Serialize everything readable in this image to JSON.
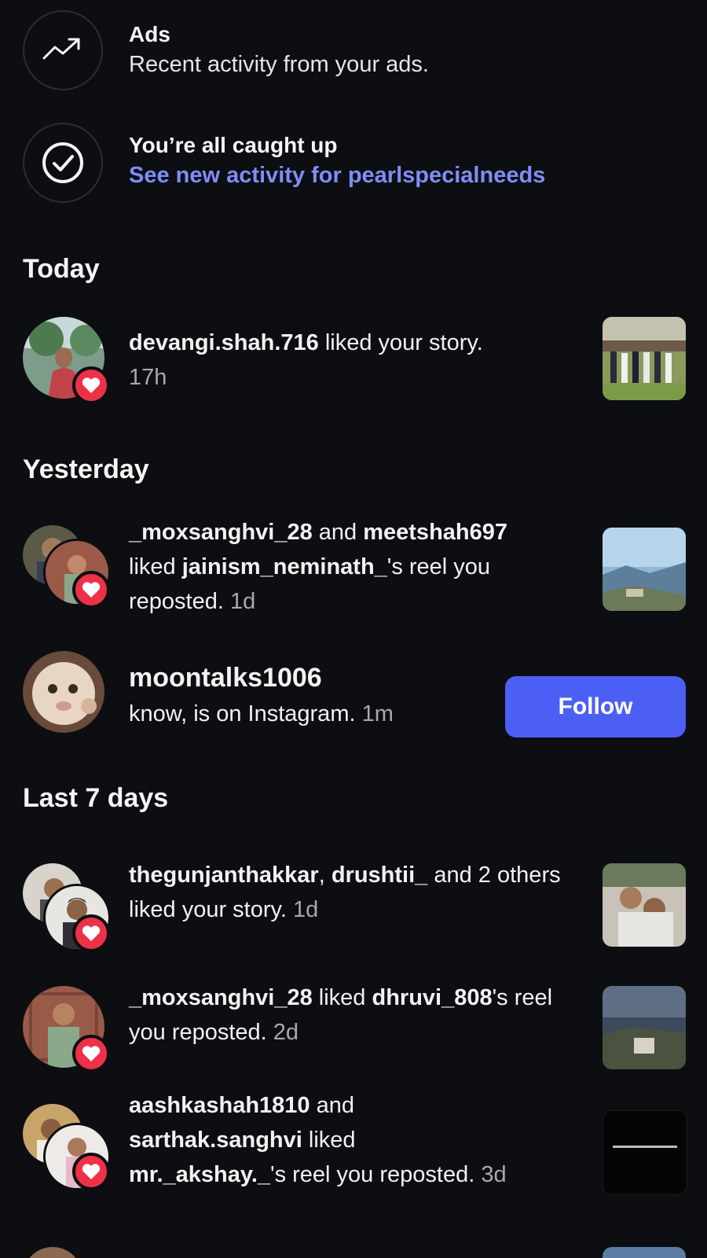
{
  "ads": {
    "title": "Ads",
    "subtitle": "Recent activity from your ads.",
    "icon": "trending-up-icon"
  },
  "caught_up": {
    "title": "You’re all caught up",
    "link": "See new activity for pearlspecialneeds",
    "icon": "check-circle-icon"
  },
  "sections": {
    "today": "Today",
    "yesterday": "Yesterday",
    "last7": "Last 7 days"
  },
  "items": {
    "devangi": {
      "user": "devangi.shah.716",
      "action": " liked your story.",
      "time": "17h"
    },
    "mox1": {
      "user1": "_moxsanghvi_28",
      "and": " and ",
      "user2": "meetshah697",
      "pre": "liked ",
      "owner": "jainism_neminath_",
      "post": "'s reel you reposted. ",
      "time": "1d"
    },
    "moontalks": {
      "user": "moontalks1006",
      "text": "know, is on Instagram. ",
      "time": "1m",
      "button": "Follow"
    },
    "gunjan": {
      "user1": "thegunjanthakkar",
      "sep": ", ",
      "user2": "drushtii_",
      "rest": " and 2 others liked your story. ",
      "time": "1d"
    },
    "mox2": {
      "user": "_moxsanghvi_28",
      "pre": " liked ",
      "owner": "dhruvi_808",
      "post": "'s reel you reposted. ",
      "time": "2d"
    },
    "aashka": {
      "user1": "aashkashah1810",
      "and": " and ",
      "user2": "sarthak.sanghvi",
      "pre": " liked ",
      "owner": "mr._akshay._",
      "post": "'s reel you reposted. ",
      "time": "3d"
    }
  },
  "colors": {
    "background": "#0c0e12",
    "link": "#7f8df6",
    "follow": "#4c5ff5",
    "heart": "#ed3147"
  }
}
